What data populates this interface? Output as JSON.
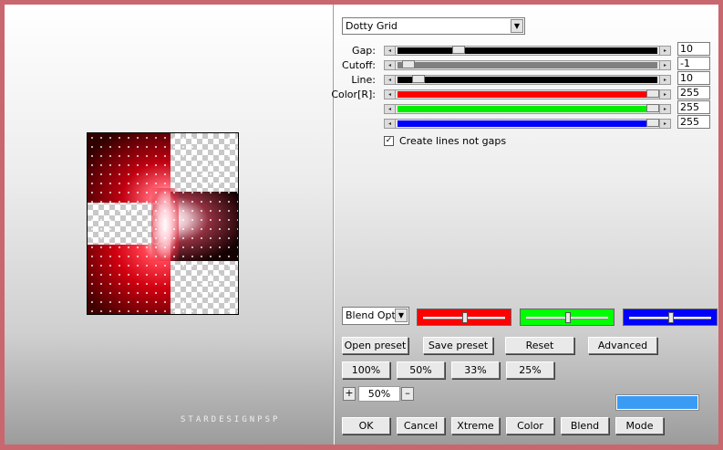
{
  "preset_dropdown": {
    "value": "Dotty Grid"
  },
  "sliders": [
    {
      "label": "Gap:",
      "value": "10",
      "fill": "#000000",
      "level": 0.22
    },
    {
      "label": "Cutoff:",
      "value": "-1",
      "fill": "#808080",
      "level": 0.02
    },
    {
      "label": "Line:",
      "value": "10",
      "fill": "#000000",
      "level": 0.06
    },
    {
      "label": "Color[R]:",
      "value": "255",
      "fill": "#ff0000",
      "level": 1.0
    },
    {
      "label": "",
      "value": "255",
      "fill": "#00ee00",
      "level": 1.0
    },
    {
      "label": "",
      "value": "255",
      "fill": "#0000ff",
      "level": 1.0
    }
  ],
  "checkbox": {
    "label": "Create lines not gaps",
    "checked": true,
    "mark": "✓"
  },
  "blend_dropdown": {
    "value": "Blend Optio"
  },
  "channel_colors": [
    "#ff0000",
    "#00ff00",
    "#0000ff"
  ],
  "preset_buttons": [
    "Open preset",
    "Save preset",
    "Reset",
    "Advanced"
  ],
  "zoom_buttons": [
    "100%",
    "50%",
    "33%",
    "25%"
  ],
  "zoom": {
    "value": "50%",
    "plus": "+",
    "minus": "–"
  },
  "footer_buttons": [
    "OK",
    "Cancel",
    "Xtreme",
    "Color",
    "Blend",
    "Mode"
  ],
  "watermark": "STARDESIGNPSP",
  "accent_color": "#3a9bf5"
}
